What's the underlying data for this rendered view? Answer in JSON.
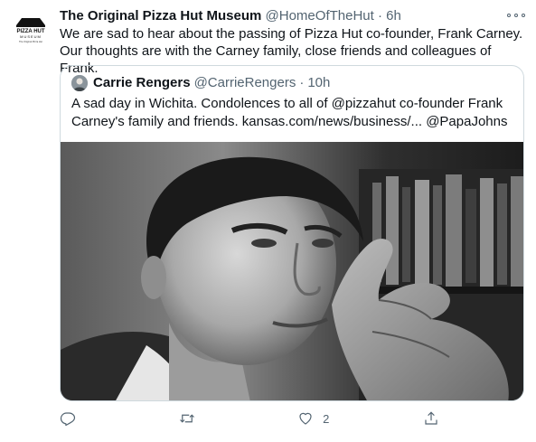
{
  "tweet": {
    "author_name": "The Original Pizza Hut Museum",
    "author_handle": "@HomeOfTheHut",
    "separator": "·",
    "time": "6h",
    "text": "We are sad to hear about the passing of Pizza Hut co-founder, Frank Carney. Our thoughts are with the Carney family, close friends and colleagues of Frank.",
    "avatar_text": {
      "line1": "PIZZA HUT",
      "line2": "MUSEUM",
      "line3": "The Original Pizza Hut"
    },
    "more_icon": "more-horizontal-icon"
  },
  "quoted_tweet": {
    "author_name": "Carrie Rengers",
    "author_handle": "@CarrieRengers",
    "separator": "·",
    "time": "10h",
    "text": "A sad day in Wichita. Condolences to all of @pizzahut co-founder Frank Carney's family and friends. kansas.com/news/business/... @PapaJohns",
    "image": "black-and-white-portrait-photo"
  },
  "actions": {
    "reply": {
      "icon": "reply-icon",
      "count": ""
    },
    "retweet": {
      "icon": "retweet-icon",
      "count": ""
    },
    "like": {
      "icon": "heart-icon",
      "count": "2"
    },
    "share": {
      "icon": "share-icon",
      "count": ""
    }
  },
  "colors": {
    "text": "#0f1419",
    "secondary": "#536471",
    "border": "#cfd9de"
  }
}
